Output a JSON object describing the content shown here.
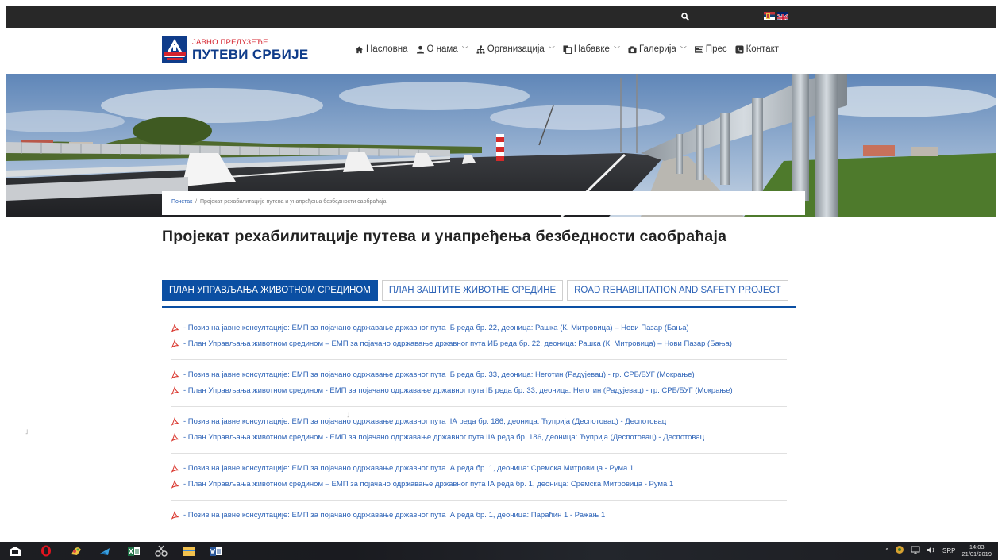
{
  "topbar": {
    "icons": [
      "search-icon",
      "flag-serbia-icon",
      "flag-uk-icon"
    ]
  },
  "logo": {
    "subtitle": "ЈАВНО ПРЕДУЗЕЋЕ",
    "title": "ПУТЕВИ СРБИЈЕ"
  },
  "nav": {
    "items": [
      {
        "label": "Насловна",
        "icon": "home-icon",
        "dropdown": false
      },
      {
        "label": "О нама",
        "icon": "user-icon",
        "dropdown": true
      },
      {
        "label": "Организација",
        "icon": "sitemap-icon",
        "dropdown": true
      },
      {
        "label": "Набавке",
        "icon": "copy-icon",
        "dropdown": true
      },
      {
        "label": "Галерија",
        "icon": "camera-icon",
        "dropdown": true
      },
      {
        "label": "Прес",
        "icon": "newspaper-icon",
        "dropdown": false
      },
      {
        "label": "Контакт",
        "icon": "phone-icon",
        "dropdown": false
      }
    ]
  },
  "breadcrumb": {
    "home": "Почетак",
    "separator": "/",
    "current": "Пројекат рехабилитације путева и унапређења безбедности саобраћаја"
  },
  "page": {
    "title": "Пројекат рехабилитације путева и унапређења безбедности саобраћаја"
  },
  "tabs": [
    {
      "label": "ПЛАН УПРАВЉАЊА ЖИВОТНОМ СРЕДИНОМ",
      "active": true
    },
    {
      "label": "ПЛАН ЗАШТИТЕ ЖИВОТНЕ СРЕДИНЕ",
      "active": false
    },
    {
      "label": "ROAD REHABILITATION AND SAFETY PROJECT",
      "active": false
    }
  ],
  "documents": {
    "groups": [
      {
        "items": [
          "- Позив на јавне консултације: ЕМП за појачано одржавање државног пута IБ реда бр. 22, деоница: Рашка (К. Митровица) – Нови Пазар (Бања)",
          "- План Управљања животном средином – ЕМП за појачано одржавање државног пута ИБ реда бр. 22, деоница: Рашка (К. Митровица) – Нови Пазар (Бања)"
        ]
      },
      {
        "items": [
          "- Позив на јавне консултације: ЕМП за појачано одржавање државног пута IБ реда бр. 33, деоница: Неготин (Радујевац) - гр. СРБ/БУГ (Мокрање)",
          "- План Управљања животном средином - ЕМП за појачано одржавање државног пута IБ реда бр. 33, деоница: Неготин (Радујевац) - гр. СРБ/БУГ (Мокрање)"
        ]
      },
      {
        "items": [
          "- Позив на јавне консултације: ЕМП за појачано одржавање државног пута IIА реда бр. 186, деоница: Ћуприја (Деспотовац) - Деспотовац",
          "- План Управљања животном средином - ЕМП за појачано одржавање државног пута IIА реда бр. 186, деоница: Ћуприја (Деспотовац) - Деспотовац"
        ]
      },
      {
        "items": [
          "- Позив на јавне консултације: ЕМП за појачано одржавање државног пута IА реда бр. 1, деоница: Сремска Митровица - Рума 1",
          "- План Управљања животном средином – ЕМП за појачано одржавање државног пута IА реда бр. 1, деоница: Сремска Митровица - Рума 1"
        ]
      },
      {
        "items": [
          "- Позив на јавне консултације: ЕМП за појачано одржавање државног пута IА реда бр. 1, деоница: Параћин 1 - Ражањ 1"
        ]
      }
    ]
  },
  "taskbar": {
    "apps": [
      "start-icon",
      "opera-icon",
      "paint-icon",
      "app-icon",
      "excel-icon",
      "snipping-tool-icon",
      "file-explorer-icon",
      "word-icon"
    ],
    "tray": {
      "language": "SRP",
      "time": "14:03",
      "date": "21/01/2019"
    }
  },
  "colors": {
    "topbar": "#282828",
    "accent_blue": "#0b4fa3",
    "link_blue": "#2d63b7",
    "logo_red": "#d5232e",
    "logo_blue": "#0f3c8a"
  }
}
